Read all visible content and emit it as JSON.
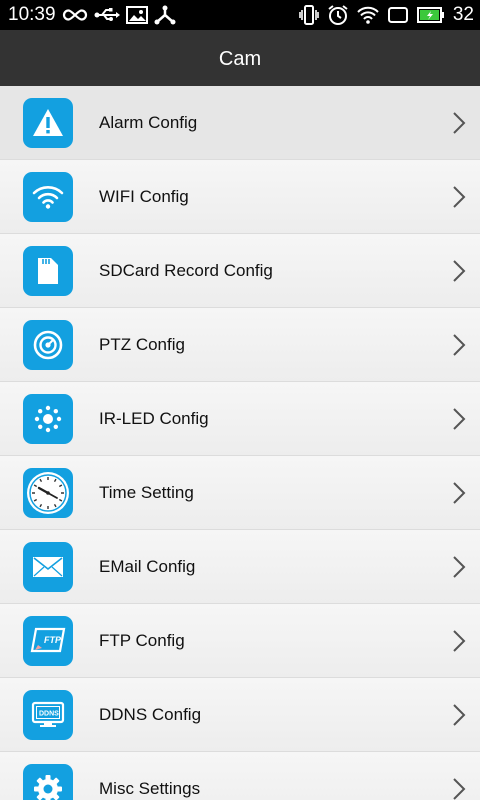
{
  "status_bar": {
    "time": "10:39",
    "battery_level": "32",
    "left_icons": [
      "infinity-icon",
      "usb-icon",
      "image-icon",
      "share-icon"
    ],
    "right_icons": [
      "vibrate-icon",
      "alarm-clock-icon",
      "wifi-icon",
      "screen-icon",
      "battery-icon"
    ]
  },
  "header": {
    "title": "Cam"
  },
  "colors": {
    "icon_background": "#13a0e0",
    "header_background": "#333333",
    "status_bar_background": "#000000"
  },
  "menu": {
    "items": [
      {
        "label": "Alarm Config",
        "icon": "warning-icon"
      },
      {
        "label": "WIFI Config",
        "icon": "wifi-icon"
      },
      {
        "label": "SDCard Record Config",
        "icon": "sdcard-icon"
      },
      {
        "label": "PTZ Config",
        "icon": "ptz-icon"
      },
      {
        "label": "IR-LED Config",
        "icon": "ir-led-icon"
      },
      {
        "label": "Time Setting",
        "icon": "clock-icon"
      },
      {
        "label": "EMail Config",
        "icon": "envelope-icon"
      },
      {
        "label": "FTP Config",
        "icon": "ftp-icon",
        "icon_text": "FTP"
      },
      {
        "label": "DDNS Config",
        "icon": "ddns-icon",
        "icon_text": "DDNS"
      },
      {
        "label": "Misc Settings",
        "icon": "gear-icon"
      }
    ]
  }
}
